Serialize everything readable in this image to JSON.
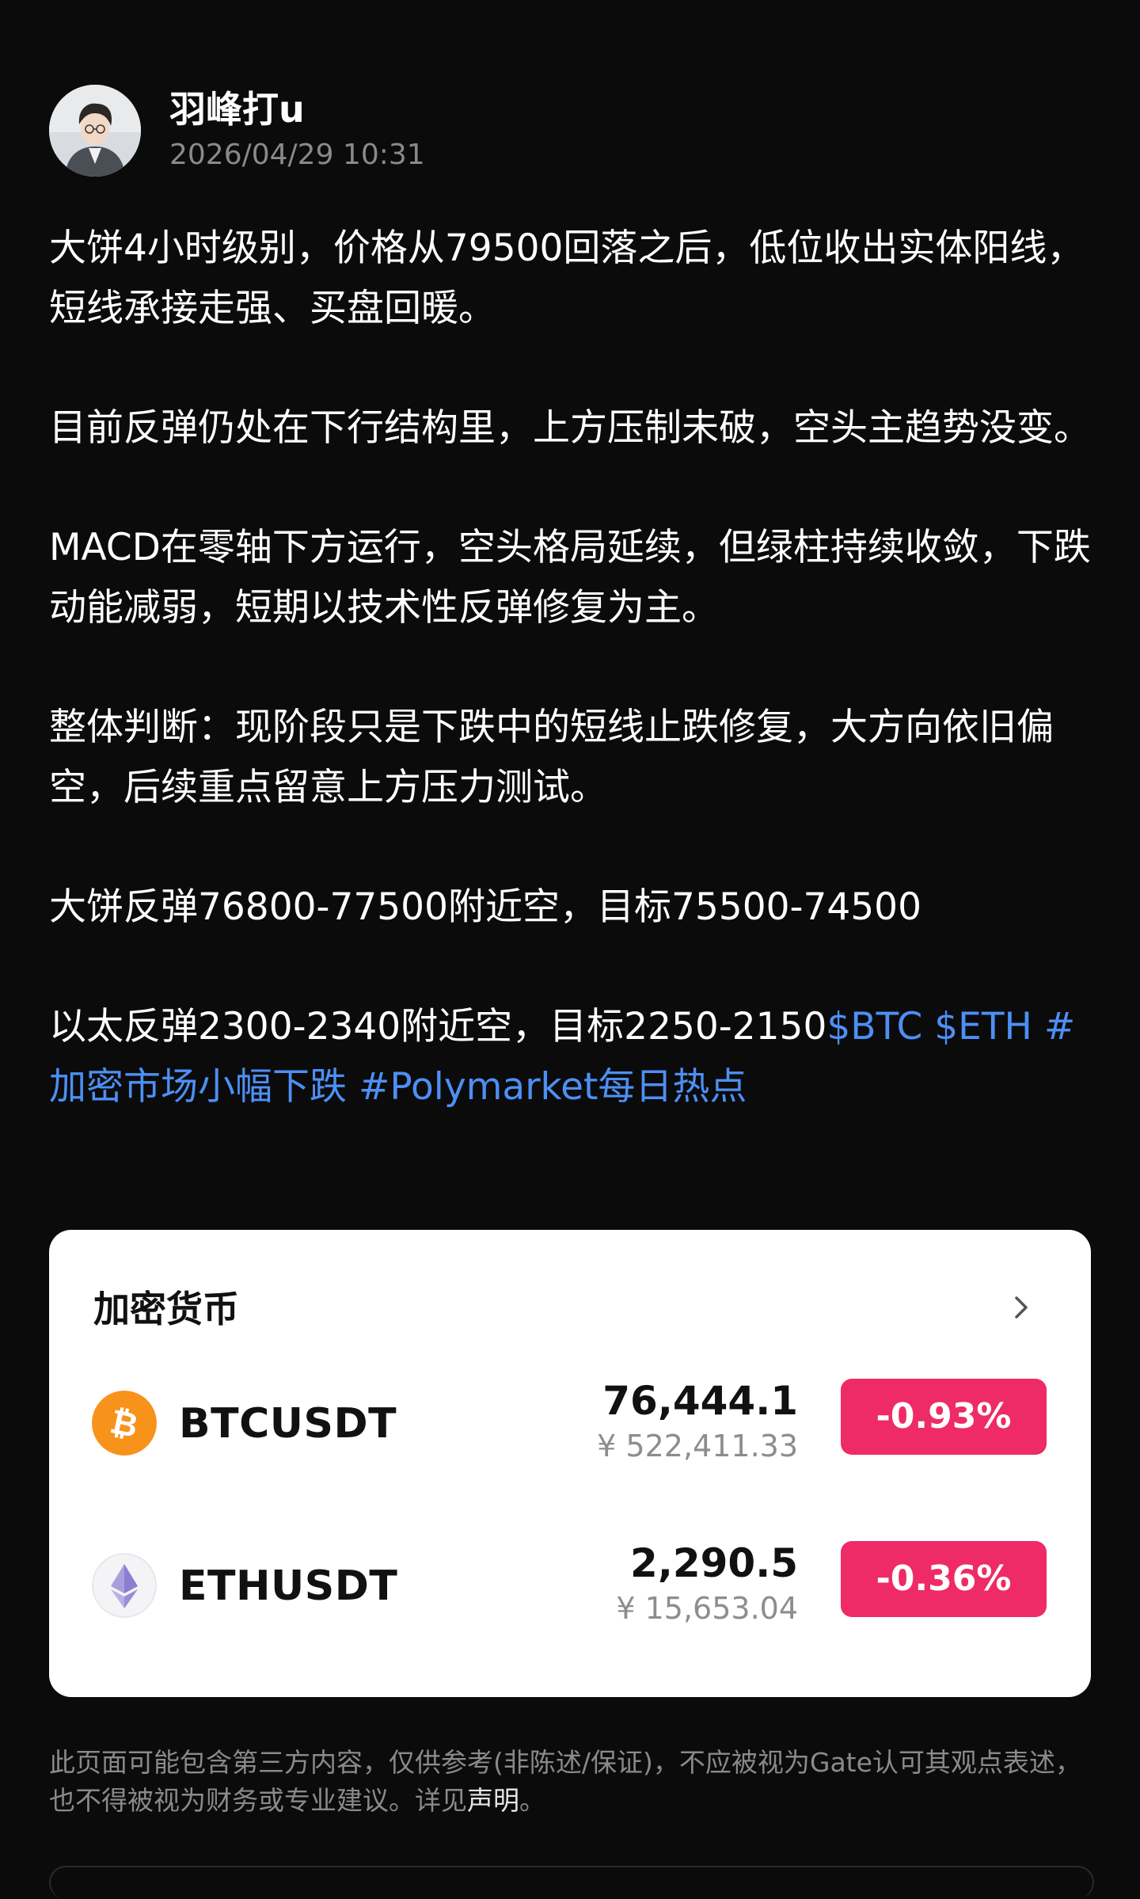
{
  "author": {
    "name": "羽峰打u",
    "time": "2026/04/29 10:31"
  },
  "post": {
    "p1": "大饼4小时级别，价格从79500回落之后，低位收出实体阳线，短线承接走强、买盘回暖。",
    "p2": "目前反弹仍处在下行结构里，上方压制未破，空头主趋势没变。",
    "p3": "MACD在零轴下方运行，空头格局延续，但绿柱持续收敛，下跌动能减弱，短期以技术性反弹修复为主。",
    "p4": "整体判断：现阶段只是下跌中的短线止跌修复，大方向依旧偏空，后续重点留意上方压力测试。",
    "p5": "大饼反弹76800-77500附近空，目标75500-74500",
    "p6": "以太反弹2300-2340附近空，目标2250-2150",
    "tags": {
      "btc": "$BTC",
      "eth": "$ETH",
      "topic1": "#加密市场小幅下跌",
      "topic2": "#Polymarket每日热点"
    }
  },
  "crypto_card": {
    "title": "加密货币",
    "icon": "chevron-right-icon",
    "coins": [
      {
        "symbol": "BTCUSDT",
        "icon": "bitcoin-icon",
        "price": "76,444.1",
        "cny": "¥ 522,411.33",
        "change": "-0.93%"
      },
      {
        "symbol": "ETHUSDT",
        "icon": "ethereum-icon",
        "price": "2,290.5",
        "cny": "¥ 15,653.04",
        "change": "-0.36%"
      }
    ]
  },
  "disclaimer": {
    "text": "此页面可能包含第三方内容，仅供参考(非陈述/保证)，不应被视为Gate认可其观点表述，也不得被视为财务或专业建议。详见",
    "link": "声明",
    "end": "。"
  },
  "colors": {
    "background": "#0b0b0b",
    "tag": "#4d8ff5",
    "negative": "#ee2b66",
    "bitcoin": "#f7931a"
  }
}
